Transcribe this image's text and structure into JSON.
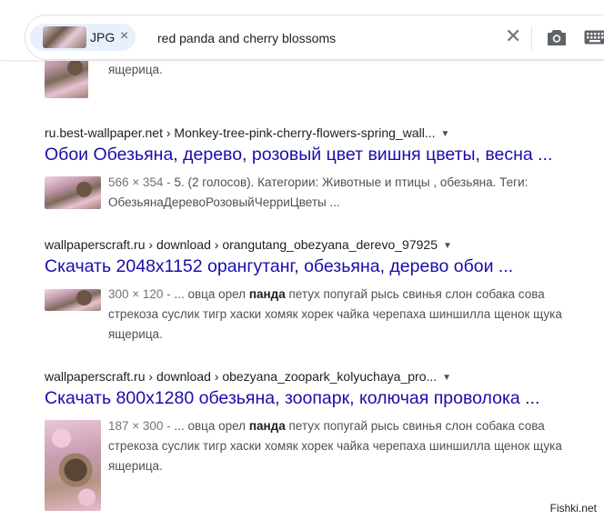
{
  "search": {
    "chip_label": "JPG",
    "chip_close": "×",
    "query": "red panda and cherry blossoms",
    "clear_icon": "close-icon",
    "camera_icon": "camera-icon",
    "keyboard_icon": "keyboard-icon"
  },
  "partial_top": {
    "snippet_tail": "ящерица."
  },
  "results": [
    {
      "cite_site": "ru.best-wallpaper.net",
      "cite_path": " › Monkey-tree-pink-cherry-flowers-spring_wall...",
      "title": "Обои Обезьяна, дерево, розовый цвет вишня цветы, весна ...",
      "snippet_meta": "566 × 354 - ",
      "snippet_line1": "5. (2 голосов). Категории: Животные и птицы , обезьяна. Теги:",
      "snippet_line2": "ОбезьянаДеревоРозовыйЧерриЦветы ..."
    },
    {
      "cite_site": "wallpaperscraft.ru",
      "cite_path": " › download › orangutang_obezyana_derevo_97925",
      "title": "Скачать 2048x1152 орангутанг, обезьяна, дерево обои ...",
      "snippet_meta": "300 × 120 - ",
      "snippet_pre": "... овца орел ",
      "snippet_bold": "панда",
      "snippet_post": " петух попугай рысь свинья слон собака сова",
      "snippet_line2": "стрекоза суслик тигр хаски хомяк хорек чайка черепаха шиншилла щенок щука",
      "snippet_line3": "ящерица."
    },
    {
      "cite_site": "wallpaperscraft.ru",
      "cite_path": " › download › obezyana_zoopark_kolyuchaya_pro...",
      "title": "Скачать 800x1280 обезьяна, зоопарк, колючая проволока ...",
      "snippet_meta": "187 × 300 - ",
      "snippet_pre": "... овца орел ",
      "snippet_bold": "панда",
      "snippet_post": " петух попугай рысь свинья слон собака сова",
      "snippet_line2": "стрекоза суслик тигр хаски хомяк хорек чайка черепаха шиншилла щенок щука",
      "snippet_line3": "ящерица."
    }
  ],
  "watermark": "Fishki.net",
  "colors": {
    "link": "#1a0dab",
    "snippet": "#4d5156",
    "chip_bg": "#e8f0fe"
  }
}
